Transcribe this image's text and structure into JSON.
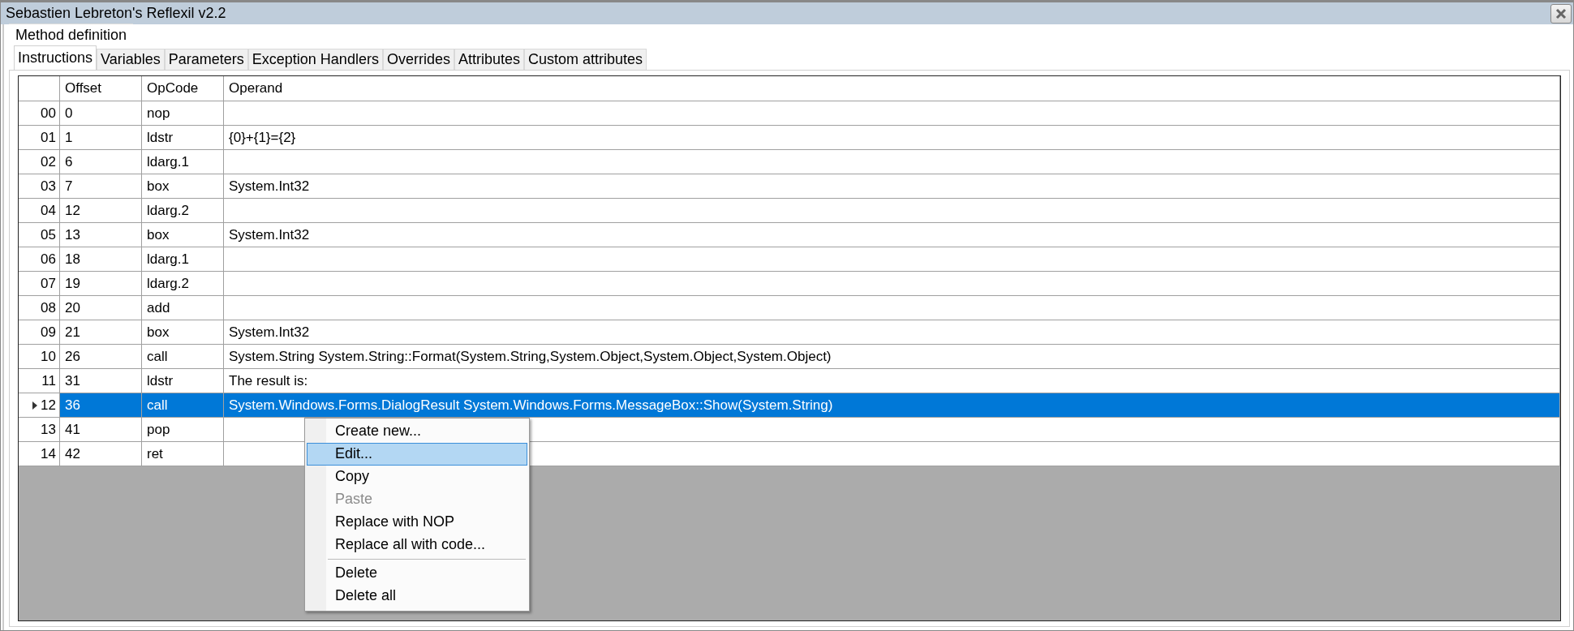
{
  "window": {
    "title": "Sebastien Lebreton's Reflexil v2.2"
  },
  "group": {
    "label": "Method definition"
  },
  "tabs": [
    {
      "label": "Instructions",
      "selected": true
    },
    {
      "label": "Variables",
      "selected": false
    },
    {
      "label": "Parameters",
      "selected": false
    },
    {
      "label": "Exception Handlers",
      "selected": false
    },
    {
      "label": "Overrides",
      "selected": false
    },
    {
      "label": "Attributes",
      "selected": false
    },
    {
      "label": "Custom attributes",
      "selected": false
    }
  ],
  "table": {
    "columns": [
      "Offset",
      "OpCode",
      "Operand"
    ],
    "rows": [
      {
        "index": "00",
        "cells": [
          "0",
          "nop",
          ""
        ],
        "selected": false
      },
      {
        "index": "01",
        "cells": [
          "1",
          "ldstr",
          "{0}+{1}={2}"
        ],
        "selected": false
      },
      {
        "index": "02",
        "cells": [
          "6",
          "ldarg.1",
          ""
        ],
        "selected": false
      },
      {
        "index": "03",
        "cells": [
          "7",
          "box",
          "System.Int32"
        ],
        "selected": false
      },
      {
        "index": "04",
        "cells": [
          "12",
          "ldarg.2",
          ""
        ],
        "selected": false
      },
      {
        "index": "05",
        "cells": [
          "13",
          "box",
          "System.Int32"
        ],
        "selected": false
      },
      {
        "index": "06",
        "cells": [
          "18",
          "ldarg.1",
          ""
        ],
        "selected": false
      },
      {
        "index": "07",
        "cells": [
          "19",
          "ldarg.2",
          ""
        ],
        "selected": false
      },
      {
        "index": "08",
        "cells": [
          "20",
          "add",
          ""
        ],
        "selected": false
      },
      {
        "index": "09",
        "cells": [
          "21",
          "box",
          "System.Int32"
        ],
        "selected": false
      },
      {
        "index": "10",
        "cells": [
          "26",
          "call",
          "System.String System.String::Format(System.String,System.Object,System.Object,System.Object)"
        ],
        "selected": false
      },
      {
        "index": "11",
        "cells": [
          "31",
          "ldstr",
          "The result is:"
        ],
        "selected": false
      },
      {
        "index": "12",
        "cells": [
          "36",
          "call",
          "System.Windows.Forms.DialogResult System.Windows.Forms.MessageBox::Show(System.String)"
        ],
        "selected": true
      },
      {
        "index": "13",
        "cells": [
          "41",
          "pop",
          ""
        ],
        "selected": false
      },
      {
        "index": "14",
        "cells": [
          "42",
          "ret",
          ""
        ],
        "selected": false
      }
    ]
  },
  "context_menu": {
    "groups": [
      [
        {
          "label": "Create new...",
          "selected": false,
          "disabled": false
        },
        {
          "label": "Edit...",
          "selected": true,
          "disabled": false
        },
        {
          "label": "Copy",
          "selected": false,
          "disabled": false
        },
        {
          "label": "Paste",
          "selected": false,
          "disabled": true
        },
        {
          "label": "Replace with NOP",
          "selected": false,
          "disabled": false
        },
        {
          "label": "Replace all with code...",
          "selected": false,
          "disabled": false
        }
      ],
      [
        {
          "label": "Delete",
          "selected": false,
          "disabled": false
        },
        {
          "label": "Delete all",
          "selected": false,
          "disabled": false
        }
      ]
    ]
  }
}
